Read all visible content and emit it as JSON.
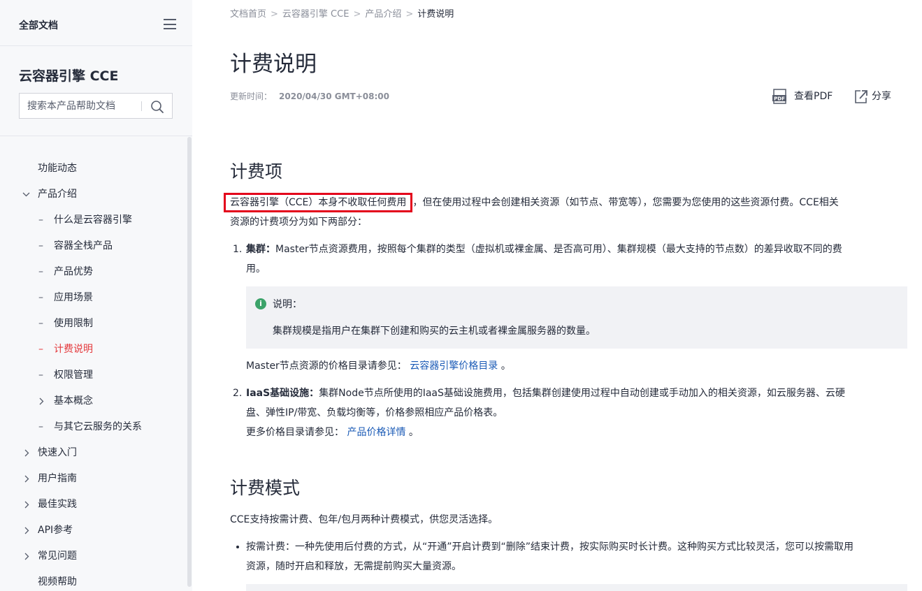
{
  "sidebar": {
    "all_docs": "全部文档",
    "product_title": "云容器引擎 CCE",
    "search_placeholder": "搜索本产品帮助文档",
    "items": [
      {
        "label": "功能动态"
      },
      {
        "label": "产品介绍"
      },
      {
        "label": "什么是云容器引擎"
      },
      {
        "label": "容器全栈产品"
      },
      {
        "label": "产品优势"
      },
      {
        "label": "应用场景"
      },
      {
        "label": "使用限制"
      },
      {
        "label": "计费说明"
      },
      {
        "label": "权限管理"
      },
      {
        "label": "基本概念"
      },
      {
        "label": "与其它云服务的关系"
      },
      {
        "label": "快速入门"
      },
      {
        "label": "用户指南"
      },
      {
        "label": "最佳实践"
      },
      {
        "label": "API参考"
      },
      {
        "label": "常见问题"
      },
      {
        "label": "视频帮助"
      }
    ]
  },
  "breadcrumb": {
    "home": "文档首页",
    "product": "云容器引擎 CCE",
    "section": "产品介绍",
    "current": "计费说明",
    "sep": ">"
  },
  "page": {
    "title": "计费说明",
    "updated_label": "更新时间：",
    "updated_value": "2020/04/30 GMT+08:00",
    "view_pdf": "查看PDF",
    "share": "分享"
  },
  "section1": {
    "heading": "计费项",
    "highlight": "云容器引擎（CCE）本身不收取任何费用",
    "intro_rest": "，但在使用过程中会创建相关资源（如节点、带宽等），您需要为您使用的这些资源付费。CCE相关",
    "intro_line2": "资源的计费项分为如下两部分：",
    "item1_num": "1.",
    "item1_bold": "集群：",
    "item1_text": "Master节点资源费用，按照每个集群的类型（虚拟机或裸金属、是否高可用）、集群规模（最大支持的节点数）的差异收取不同的费",
    "item1_line2": "用。",
    "note_label": "说明：",
    "note_text": "集群规模是指用户在集群下创建和购买的云主机或者裸金属服务器的数量。",
    "master_price_prefix": "Master节点资源的价格目录请参见：",
    "master_price_link": "云容器引擎价格目录",
    "master_price_suffix": "。",
    "item2_num": "2.",
    "item2_bold": "IaaS基础设施：",
    "item2_text": "集群Node节点所使用的IaaS基础设施费用，包括集群创建使用过程中自动创建或手动加入的相关资源，如云服务器、云硬",
    "item2_line2": "盘、弹性IP/带宽、负载均衡等，价格参照相应产品价格表。",
    "more_prefix": "更多价格目录请参见：",
    "more_link": "产品价格详情",
    "more_suffix": "。"
  },
  "section2": {
    "heading": "计费模式",
    "intro": "CCE支持按需计费、包年/包月两种计费模式，供您灵活选择。",
    "bullet1_line1": "按需计费：一种先使用后付费的方式，从“开通”开启计费到“删除”结束计费，按实际购买时长计费。这种购买方式比较灵活，您可以按需取用",
    "bullet1_line2": "资源，随时开启和释放，无需提前购买大量资源。"
  },
  "colors": {
    "accent_red": "#e4393c",
    "highlight_border": "#e3001b",
    "link_blue": "#1a5ab6",
    "info_green": "#3ca36a"
  }
}
